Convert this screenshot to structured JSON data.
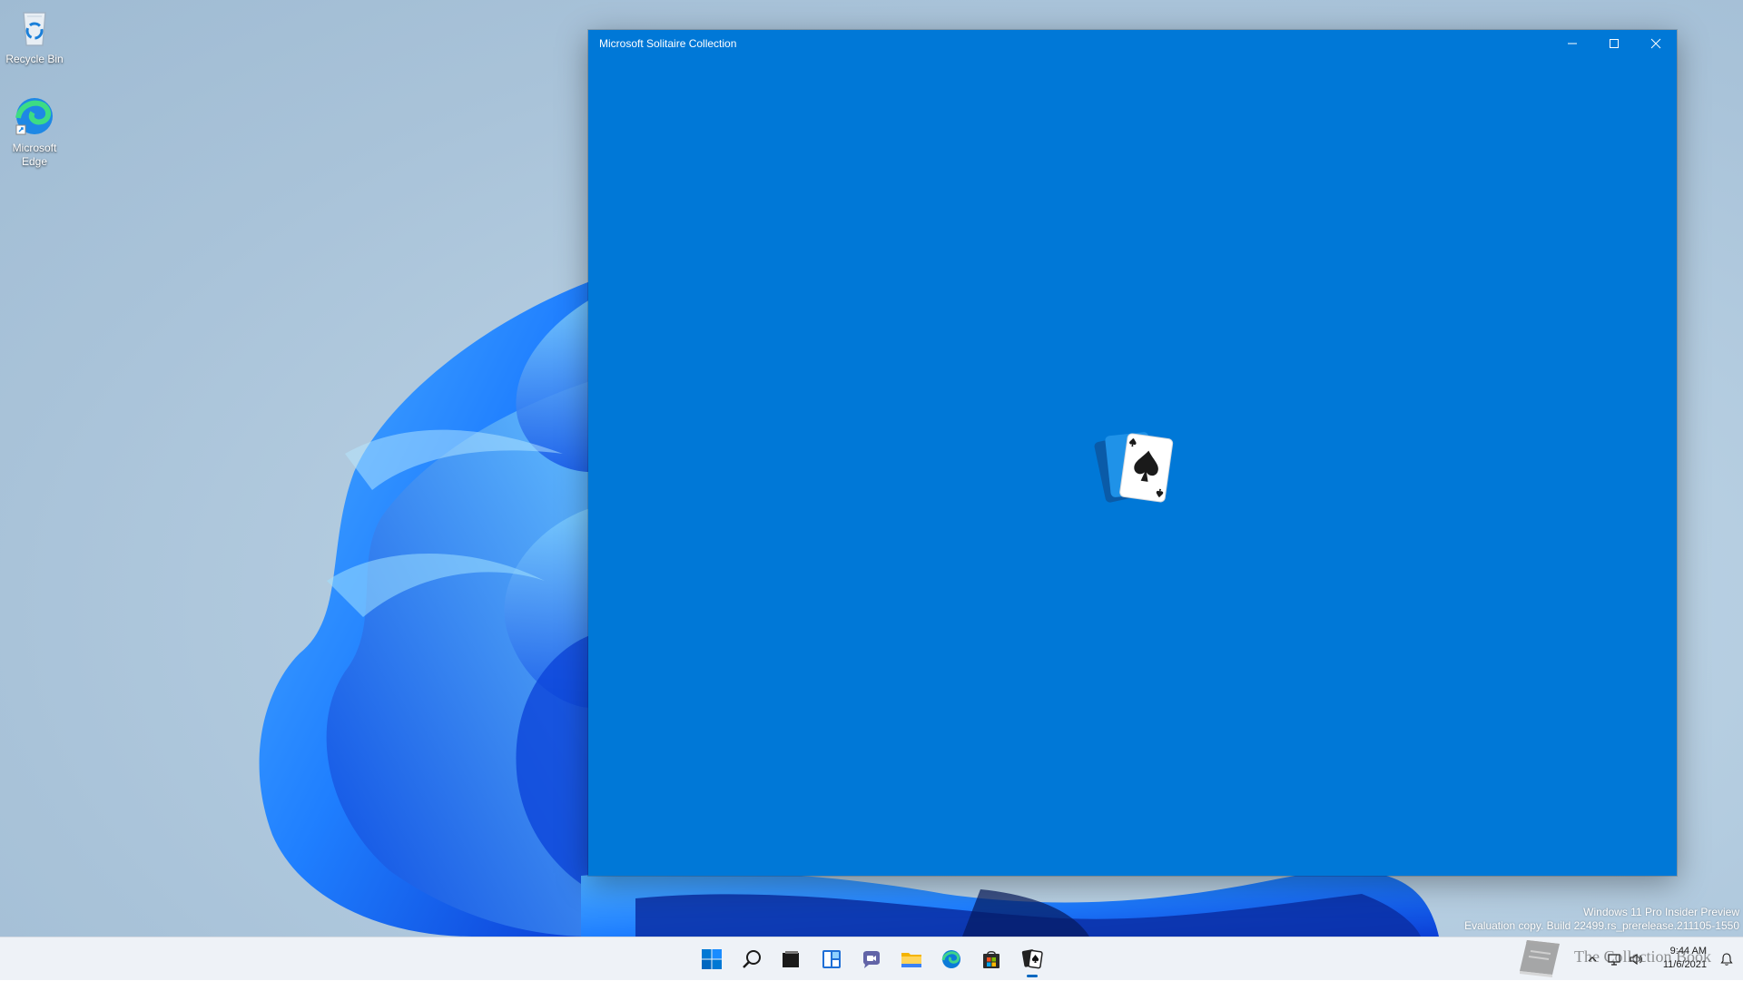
{
  "desktop": {
    "icons": [
      {
        "label": "Recycle Bin",
        "icon": "recycle-bin-icon"
      },
      {
        "label": "Microsoft\nEdge",
        "icon": "edge-icon"
      }
    ],
    "watermark": {
      "line1": "Windows 11 Pro Insider Preview",
      "line2": "Evaluation copy. Build 22499.rs_prerelease.211105-1550"
    }
  },
  "window": {
    "title": "Microsoft Solitaire Collection",
    "background_color": "#0078d7",
    "splash_icon": "solitaire-cards-icon",
    "controls": [
      "minimize-icon",
      "maximize-icon",
      "close-icon"
    ]
  },
  "taskbar": {
    "icons": [
      "start-icon",
      "search-icon",
      "task-view-icon",
      "widgets-icon",
      "chat-icon",
      "file-explorer-icon",
      "edge-icon",
      "store-icon",
      "solitaire-icon"
    ],
    "active": "solitaire-icon",
    "clock": {
      "time": "9:44 AM",
      "date": "11/6/2021"
    },
    "brand_text": "The Collection Book"
  }
}
